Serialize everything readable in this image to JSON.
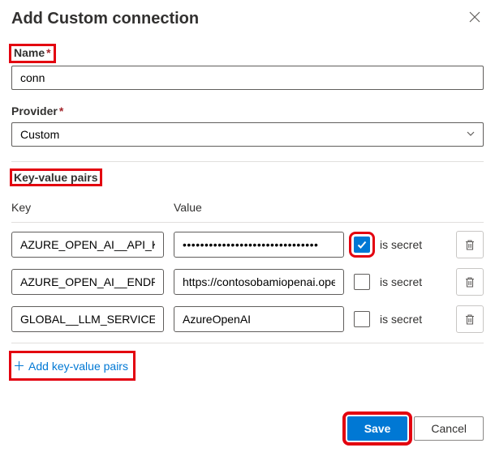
{
  "dialog": {
    "title": "Add Custom connection"
  },
  "fields": {
    "name_label": "Name",
    "name_value": "conn",
    "provider_label": "Provider",
    "provider_value": "Custom"
  },
  "kv": {
    "heading": "Key-value pairs",
    "col_key": "Key",
    "col_value": "Value",
    "secret_label_0": "is secret",
    "secret_label_1": "is secret",
    "secret_label_2": "is secret",
    "rows": [
      {
        "key": "AZURE_OPEN_AI__API_KEY",
        "value": "",
        "secret": true
      },
      {
        "key": "AZURE_OPEN_AI__ENDPOINT",
        "value": "https://contosobamiopenai.ope",
        "secret": false
      },
      {
        "key": "GLOBAL__LLM_SERVICE",
        "value": "AzureOpenAI",
        "secret": false
      }
    ],
    "add_link": "Add key-value pairs"
  },
  "footer": {
    "save": "Save",
    "cancel": "Cancel"
  },
  "secret_mask": "•••••••••••••••••••••••••••••••"
}
